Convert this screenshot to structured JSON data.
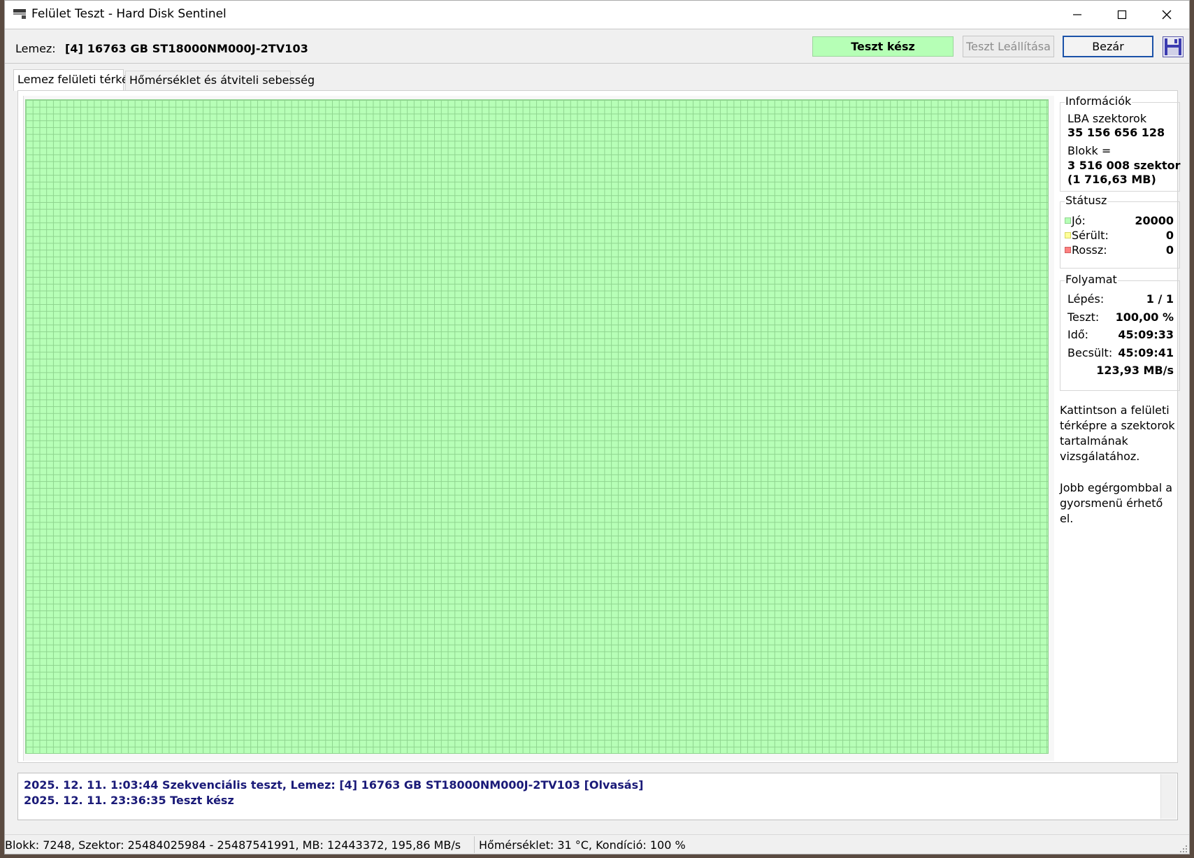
{
  "window": {
    "title": "Felület Teszt - Hard Disk Sentinel"
  },
  "toolbar": {
    "disk_label": "Lemez:",
    "disk_value": "[4] 16763 GB  ST18000NM000J-2TV103",
    "status_text": "Teszt kész",
    "stop_button": "Teszt Leállítása",
    "close_button": "Bezár"
  },
  "tabs": [
    {
      "label": "Lemez felületi térkép",
      "active": true
    },
    {
      "label": "Hőmérséklet és átviteli sebesség",
      "active": false
    }
  ],
  "info": {
    "title": "Információk",
    "lba_label": "LBA szektorok",
    "lba_value": "35 156 656 128",
    "block_label": "Blokk =",
    "block_value_1": "3 516 008 szektor",
    "block_value_2": "(1 716,63 MB)"
  },
  "status": {
    "title": "Státusz",
    "items": [
      {
        "label": "Jó:",
        "value": "20000",
        "color": "#b6ffb6"
      },
      {
        "label": "Sérült:",
        "value": "0",
        "color": "#ffff99"
      },
      {
        "label": "Rossz:",
        "value": "0",
        "color": "#ff8080"
      }
    ]
  },
  "progress": {
    "title": "Folyamat",
    "step_label": "Lépés:",
    "step_value": "1 / 1",
    "test_label": "Teszt:",
    "test_value": "100,00 %",
    "time_label": "Idő:",
    "time_value": "45:09:33",
    "est_label": "Becsült:",
    "est_value": "45:09:41",
    "speed": "123,93 MB/s"
  },
  "help": {
    "lines_1": [
      "Kattintson a felületi",
      "térképre a szektorok",
      "tartalmának",
      "vizsgálatához."
    ],
    "lines_2": [
      "Jobb egérgombbal a",
      "gyorsmenü érhető el."
    ]
  },
  "log": [
    "2025. 12. 11.  1:03:44   Szekvenciális teszt, Lemez: [4] 16763 GB  ST18000NM000J-2TV103  [Olvasás]",
    "2025. 12. 11.  23:36:35   Teszt kész"
  ],
  "statusbar": {
    "left": "Blokk: 7248, Szektor: 25484025984 - 25487541991, MB: 12443372, 195,86 MB/s",
    "right": "Hőmérséklet: 31  °C,  Kondíció: 100 %"
  },
  "colors": {
    "map_good": "#b7ffb7",
    "map_grid": "#8fd48f",
    "log_text": "#1a1a78",
    "close_button_border": "#1b52a8"
  },
  "icons": {
    "app": "hard-disk-icon",
    "minimize": "minimize-icon",
    "maximize": "maximize-icon",
    "close": "close-icon",
    "save": "floppy-disk-icon"
  }
}
